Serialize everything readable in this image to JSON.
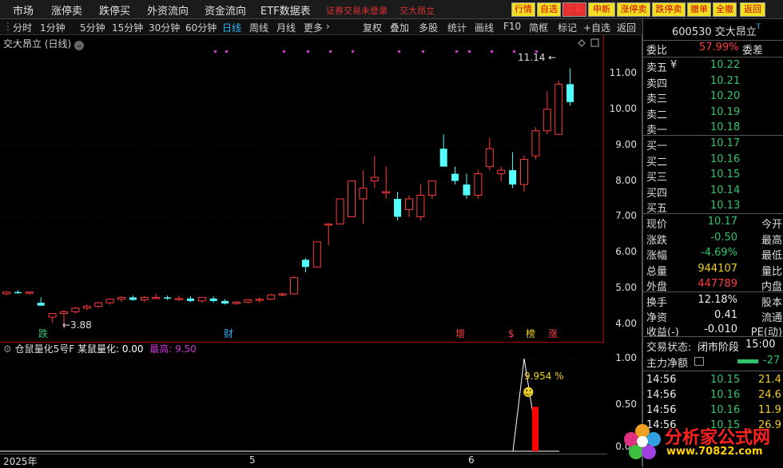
{
  "topbar": {
    "menus": [
      "市场",
      "涨停卖",
      "跌停买",
      "外资流向",
      "资金流向",
      "ETF数据表"
    ],
    "warning": "证券交易未登录",
    "stock_name_red": "交大昂立",
    "buttons": [
      "行情",
      "自选",
      "交易",
      "申新",
      "涨停卖",
      "跌停卖",
      "撤单",
      "全撤",
      "返回"
    ]
  },
  "toolbar": {
    "periods": [
      "分时",
      "1分钟",
      "5分钟",
      "15分钟",
      "30分钟",
      "60分钟",
      "日线",
      "周线",
      "月线",
      "更多"
    ],
    "active_period": "日线",
    "tools": [
      "复权",
      "叠加",
      "多股",
      "统计",
      "画线",
      "F10",
      "简框",
      "标记",
      "+自选",
      "返回"
    ]
  },
  "chart": {
    "title": "交大昂立 (日线)",
    "high_label": "11.14",
    "low_label": "3.88",
    "price_ticks": [
      "11.00",
      "10.00",
      "9.00",
      "8.00",
      "7.00",
      "6.00",
      "5.00",
      "4.00"
    ],
    "markers": [
      {
        "text": "跌",
        "color": "#31c46b"
      },
      {
        "text": "财",
        "color": "#29b6f6"
      },
      {
        "text": "增",
        "color": "#ff3b3b"
      },
      {
        "text": "$",
        "color": "#ff3b3b"
      },
      {
        "text": "榜",
        "color": "#f0d020"
      },
      {
        "text": "涨",
        "color": "#ff3b3b"
      }
    ],
    "candles": [
      [
        4.85,
        4.9,
        4.8,
        4.9
      ],
      [
        4.9,
        4.95,
        4.85,
        4.88
      ],
      [
        4.88,
        4.92,
        4.83,
        4.9
      ],
      [
        4.6,
        4.75,
        4.52,
        4.52
      ],
      [
        4.2,
        4.3,
        4.05,
        4.3
      ],
      [
        4.3,
        4.4,
        3.88,
        4.35
      ],
      [
        4.35,
        4.48,
        4.3,
        4.45
      ],
      [
        4.45,
        4.55,
        4.4,
        4.5
      ],
      [
        4.5,
        4.62,
        4.45,
        4.6
      ],
      [
        4.6,
        4.72,
        4.55,
        4.7
      ],
      [
        4.7,
        4.78,
        4.62,
        4.75
      ],
      [
        4.75,
        4.8,
        4.65,
        4.68
      ],
      [
        4.68,
        4.78,
        4.62,
        4.75
      ],
      [
        4.75,
        4.85,
        4.7,
        4.75
      ],
      [
        4.75,
        4.8,
        4.68,
        4.72
      ],
      [
        4.72,
        4.8,
        4.65,
        4.72
      ],
      [
        4.72,
        4.78,
        4.62,
        4.65
      ],
      [
        4.65,
        4.72,
        4.6,
        4.75
      ],
      [
        4.72,
        4.78,
        4.6,
        4.65
      ],
      [
        4.65,
        4.7,
        4.55,
        4.58
      ],
      [
        4.58,
        4.65,
        4.55,
        4.62
      ],
      [
        4.62,
        4.7,
        4.58,
        4.68
      ],
      [
        4.68,
        4.75,
        4.6,
        4.7
      ],
      [
        4.7,
        4.85,
        4.68,
        4.82
      ],
      [
        4.82,
        4.88,
        4.78,
        4.85
      ],
      [
        4.85,
        5.35,
        4.82,
        5.3
      ],
      [
        5.8,
        5.85,
        5.45,
        5.6
      ],
      [
        5.6,
        6.3,
        5.58,
        6.3
      ],
      [
        6.8,
        6.8,
        6.2,
        6.8
      ],
      [
        6.8,
        7.5,
        6.8,
        7.5
      ],
      [
        7.0,
        8.0,
        7.0,
        8.0
      ],
      [
        7.5,
        8.3,
        6.8,
        7.8
      ],
      [
        8.0,
        8.7,
        7.8,
        8.1
      ],
      [
        7.7,
        8.4,
        7.5,
        7.7
      ],
      [
        7.5,
        7.7,
        6.9,
        7.0
      ],
      [
        7.2,
        7.6,
        7.0,
        7.5
      ],
      [
        7.0,
        7.9,
        6.9,
        7.6
      ],
      [
        7.6,
        8.0,
        7.5,
        8.0
      ],
      [
        8.9,
        9.3,
        8.4,
        8.4
      ],
      [
        8.2,
        8.4,
        7.9,
        8.0
      ],
      [
        7.9,
        8.2,
        7.5,
        7.6
      ],
      [
        7.6,
        8.3,
        7.5,
        8.2
      ],
      [
        8.4,
        9.2,
        8.3,
        8.9
      ],
      [
        8.2,
        8.4,
        8.0,
        8.3
      ],
      [
        8.3,
        8.8,
        7.8,
        7.9
      ],
      [
        7.9,
        8.7,
        7.7,
        8.6
      ],
      [
        8.7,
        9.5,
        8.6,
        9.4
      ],
      [
        9.4,
        10.5,
        9.3,
        10.0
      ],
      [
        9.3,
        10.8,
        9.3,
        10.7
      ],
      [
        10.7,
        11.14,
        10.1,
        10.2
      ]
    ]
  },
  "indicator": {
    "name": "仓鼠量化5号F",
    "label": "某鼠量化:",
    "value": "0.00",
    "max_label": "最高:",
    "max_value": "9.50",
    "percent": "9.954 %",
    "ticks": [
      "1.00",
      "0.50",
      "0.00"
    ],
    "peak_index": 45,
    "bar_value": 0.48
  },
  "dates": {
    "year": "2025年",
    "m5": "5",
    "m6": "6"
  },
  "quote": {
    "code": "600530",
    "name": "交大昂立",
    "tag": "T",
    "webi_label": "委比",
    "webi": "57.99%",
    "weicha_label": "委差",
    "sells": [
      {
        "label": "卖五",
        "price": "10.22"
      },
      {
        "label": "卖四",
        "price": "10.21"
      },
      {
        "label": "卖三",
        "price": "10.20"
      },
      {
        "label": "卖二",
        "price": "10.19"
      },
      {
        "label": "卖一",
        "price": "10.18"
      }
    ],
    "yen": "¥",
    "buys": [
      {
        "label": "买一",
        "price": "10.17"
      },
      {
        "label": "买二",
        "price": "10.16"
      },
      {
        "label": "买三",
        "price": "10.15"
      },
      {
        "label": "买四",
        "price": "10.14"
      },
      {
        "label": "买五",
        "price": "10.13"
      }
    ],
    "stats": [
      {
        "label": "现价",
        "value": "10.17",
        "color": "green",
        "label2": "今开"
      },
      {
        "label": "涨跌",
        "value": "-0.50",
        "color": "green",
        "label2": "最高"
      },
      {
        "label": "涨幅",
        "value": "-4.69%",
        "color": "green",
        "label2": "最低"
      },
      {
        "label": "总量",
        "value": "944107",
        "color": "yellow",
        "label2": "量比"
      },
      {
        "label": "外盘",
        "value": "447789",
        "color": "red",
        "label2": "内盘"
      }
    ],
    "stats2": [
      {
        "label": "换手",
        "value": "12.18%",
        "label2": "股本"
      },
      {
        "label": "净资",
        "value": "0.41",
        "label2": "流通"
      },
      {
        "label": "收益(-)",
        "value": "-0.010",
        "label2": "PE(动)"
      }
    ],
    "trade_state_label": "交易状态:",
    "trade_state": "闭市阶段",
    "trade_time": "15:00",
    "mainflow_label": "主力净额",
    "mainflow_value": "-27",
    "ticks": [
      {
        "time": "14:56",
        "price": "10.15",
        "vol": "21.4"
      },
      {
        "time": "14:56",
        "price": "10.16",
        "vol": "24.6"
      },
      {
        "time": "14:56",
        "price": "10.16",
        "vol": "11.9"
      },
      {
        "time": "14:56",
        "price": "10.15",
        "vol": "26.9"
      }
    ]
  },
  "watermark": {
    "name": "分析家公式网",
    "url": "www.70822.com"
  }
}
